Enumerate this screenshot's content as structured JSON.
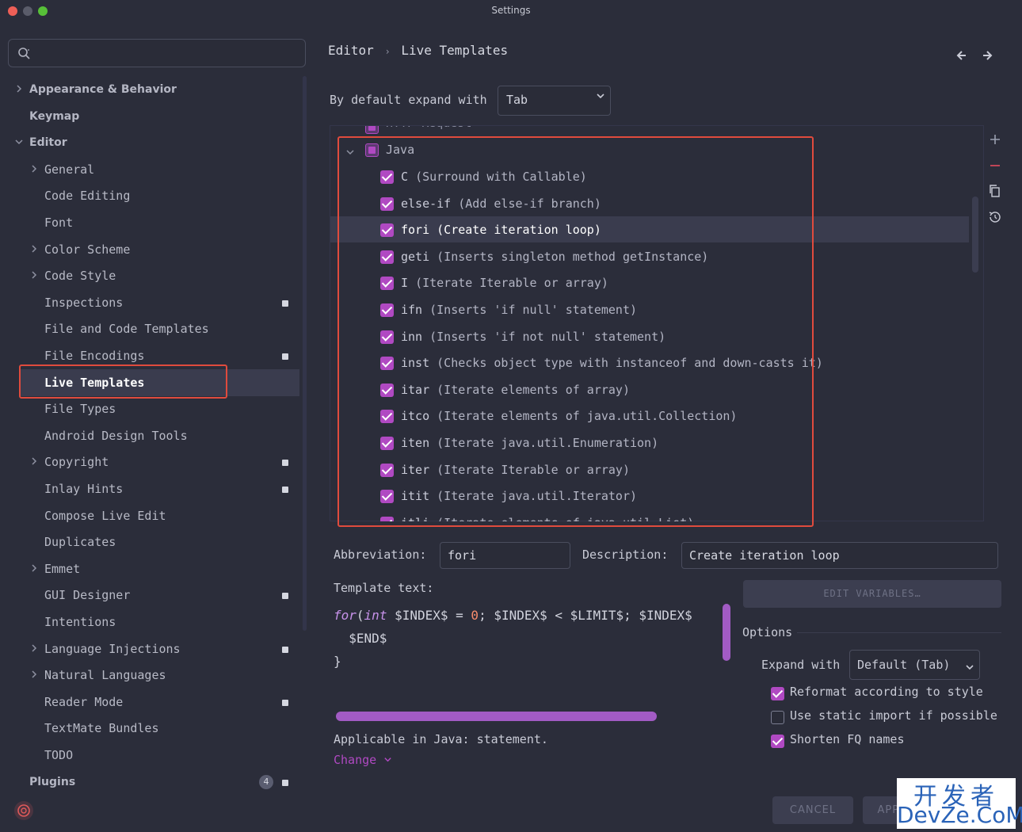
{
  "window": {
    "title": "Settings"
  },
  "colors": {
    "accent": "#b049c2",
    "highlight_border": "#e04b3d",
    "background": "#2b2d3a"
  },
  "sidebar": {
    "search_placeholder": "",
    "items": [
      {
        "label": "Appearance & Behavior",
        "level": 0,
        "expandable": true
      },
      {
        "label": "Keymap",
        "level": 0
      },
      {
        "label": "Editor",
        "level": 0,
        "expanded": true
      },
      {
        "label": "General",
        "level": 1,
        "expandable": true
      },
      {
        "label": "Code Editing",
        "level": 1
      },
      {
        "label": "Font",
        "level": 1
      },
      {
        "label": "Color Scheme",
        "level": 1,
        "expandable": true
      },
      {
        "label": "Code Style",
        "level": 1,
        "expandable": true
      },
      {
        "label": "Inspections",
        "level": 1,
        "badge": true
      },
      {
        "label": "File and Code Templates",
        "level": 1
      },
      {
        "label": "File Encodings",
        "level": 1,
        "badge": true
      },
      {
        "label": "Live Templates",
        "level": 1,
        "selected": true
      },
      {
        "label": "File Types",
        "level": 1
      },
      {
        "label": "Android Design Tools",
        "level": 1
      },
      {
        "label": "Copyright",
        "level": 1,
        "expandable": true,
        "badge": true
      },
      {
        "label": "Inlay Hints",
        "level": 1,
        "badge": true
      },
      {
        "label": "Compose Live Edit",
        "level": 1
      },
      {
        "label": "Duplicates",
        "level": 1
      },
      {
        "label": "Emmet",
        "level": 1,
        "expandable": true
      },
      {
        "label": "GUI Designer",
        "level": 1,
        "badge": true
      },
      {
        "label": "Intentions",
        "level": 1
      },
      {
        "label": "Language Injections",
        "level": 1,
        "expandable": true,
        "badge": true
      },
      {
        "label": "Natural Languages",
        "level": 1,
        "expandable": true
      },
      {
        "label": "Reader Mode",
        "level": 1,
        "badge": true
      },
      {
        "label": "TextMate Bundles",
        "level": 1
      },
      {
        "label": "TODO",
        "level": 1
      },
      {
        "label": "Plugins",
        "level": 0,
        "count": "4",
        "badge": true
      }
    ]
  },
  "header": {
    "breadcrumb_parent": "Editor",
    "breadcrumb_sep": "›",
    "breadcrumb_current": "Live Templates",
    "back_icon": "arrow-left-icon",
    "forward_icon": "arrow-right-icon"
  },
  "expand": {
    "label": "By default expand with",
    "value": "Tab"
  },
  "tree": {
    "partial_above": "HTTP Request",
    "group": "Java",
    "items": [
      {
        "abbr": "C",
        "desc": "(Surround with Callable)"
      },
      {
        "abbr": "else-if",
        "desc": "(Add else-if branch)"
      },
      {
        "abbr": "fori",
        "desc": "(Create iteration loop)",
        "selected": true
      },
      {
        "abbr": "geti",
        "desc": "(Inserts singleton method getInstance)"
      },
      {
        "abbr": "I",
        "desc": "(Iterate Iterable or array)"
      },
      {
        "abbr": "ifn",
        "desc": "(Inserts 'if null' statement)"
      },
      {
        "abbr": "inn",
        "desc": "(Inserts 'if not null' statement)"
      },
      {
        "abbr": "inst",
        "desc": "(Checks object type with instanceof and down-casts it)"
      },
      {
        "abbr": "itar",
        "desc": "(Iterate elements of array)"
      },
      {
        "abbr": "itco",
        "desc": "(Iterate elements of java.util.Collection)"
      },
      {
        "abbr": "iten",
        "desc": "(Iterate java.util.Enumeration)"
      },
      {
        "abbr": "iter",
        "desc": "(Iterate Iterable or array)"
      },
      {
        "abbr": "itit",
        "desc": "(Iterate java.util.Iterator)"
      },
      {
        "abbr": "itli",
        "desc": "(Iterate elements of java.util.List)"
      }
    ]
  },
  "details": {
    "abbreviation_label": "Abbreviation:",
    "abbreviation_value": "fori",
    "description_label": "Description:",
    "description_value": "Create iteration loop",
    "template_label": "Template text:",
    "code": {
      "kw_for": "for",
      "paren": "(",
      "kw_int": "int",
      "l1_a": " $INDEX$ = ",
      "zero": "0",
      "l1_b": "; $INDEX$ < $LIMIT$; $INDEX$",
      "line2": "  $END$",
      "line3": "}"
    },
    "edit_variables": "EDIT VARIABLES…",
    "options_title": "Options",
    "expand_with_label": "Expand with",
    "expand_with_value": "Default (Tab)",
    "options": [
      {
        "label": "Reformat according to style",
        "checked": true
      },
      {
        "label": "Use static import if possible",
        "checked": false
      },
      {
        "label": "Shorten FQ names",
        "checked": true
      }
    ],
    "applicable": "Applicable in Java: statement.",
    "change": "Change"
  },
  "buttons": {
    "cancel": "CANCEL",
    "apply": "APPLY"
  },
  "watermark": {
    "cn": "开发者",
    "en": "DevZe.CoM"
  }
}
